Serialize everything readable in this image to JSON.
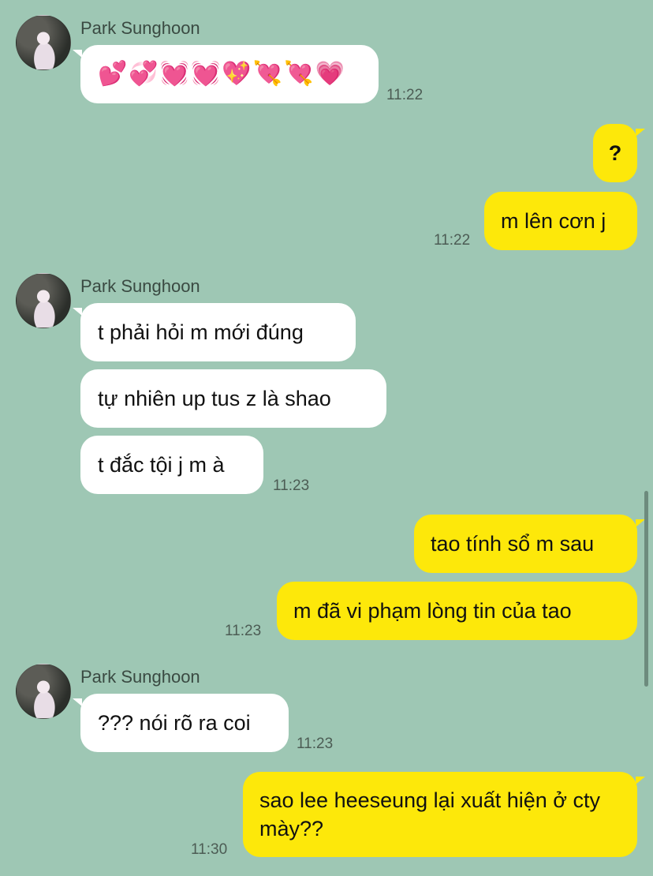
{
  "contact": {
    "name": "Park Sunghoon"
  },
  "messages": [
    {
      "from": "them",
      "text": "💕💞💓💓💖💘💘💗",
      "time": "11:22"
    },
    {
      "from": "me",
      "text": "?"
    },
    {
      "from": "me",
      "text": "m lên cơn j",
      "time": "11:22"
    },
    {
      "from": "them",
      "text": "t phải hỏi m mới đúng"
    },
    {
      "from": "them",
      "text": "tự nhiên up tus z là shao"
    },
    {
      "from": "them",
      "text": "t đắc tội j m à",
      "time": "11:23"
    },
    {
      "from": "me",
      "text": "tao tính sổ m sau"
    },
    {
      "from": "me",
      "text": "m đã vi phạm lòng tin của tao",
      "time": "11:23"
    },
    {
      "from": "them",
      "text": "??? nói rõ ra coi",
      "time": "11:23"
    },
    {
      "from": "me",
      "text": "sao lee heeseung lại xuất hiện ở cty mày??",
      "time": "11:30"
    }
  ],
  "colors": {
    "background": "#9ec7b4",
    "outgoing": "#fde80a",
    "incoming": "#ffffff"
  }
}
